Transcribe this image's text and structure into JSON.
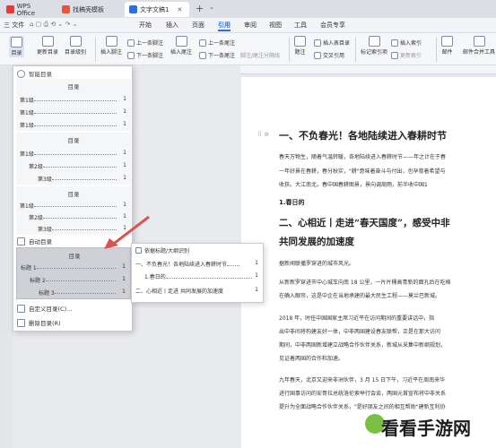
{
  "titlebar": {
    "tabs": [
      "WPS Office",
      "找稿壳模板",
      "文字文稿1"
    ],
    "add_label": "+"
  },
  "menubar": {
    "file_label": "三 文件",
    "items": [
      "开始",
      "插入",
      "页面",
      "引用",
      "审阅",
      "视图",
      "工具",
      "会员专享"
    ],
    "active": "引用"
  },
  "ribbon": {
    "toc_label": "目录",
    "update_toc_label": "更新目录",
    "toc_level_label": "目录级别",
    "insert_footnote_label": "插入脚注",
    "prev_footnote_label": "上一条脚注",
    "next_footnote_label": "下一条脚注",
    "insert_endnote_label": "插入尾注",
    "prev_endnote_label": "上一条尾注",
    "next_endnote_label": "下一条尾注",
    "note_settings_label": "脚注/尾注分隔线",
    "caption_label": "题注",
    "insert_table_of_figures_label": "插入表目录",
    "cross_ref_label": "交叉引用",
    "mark_index_label": "标记索引项",
    "insert_index_label": "插入索引",
    "update_index_label": "更新索引",
    "mail_label": "邮件",
    "mail_merge_label": "邮件合并工具"
  },
  "toc_panel": {
    "smart_toc_label": "智能目录",
    "group1": {
      "title": "目录",
      "items": [
        {
          "label": "第1级",
          "page": "1"
        },
        {
          "label": "第1级",
          "page": "1"
        },
        {
          "label": "第1级",
          "page": "1"
        }
      ]
    },
    "group2": {
      "title": "目录",
      "items": [
        {
          "label": "第1级",
          "page": "1"
        },
        {
          "label": "第2级",
          "page": "1"
        },
        {
          "label": "第3级",
          "page": "1"
        }
      ]
    },
    "group3": {
      "title": "目录",
      "items": [
        {
          "label": "第1级",
          "page": "1"
        },
        {
          "label": "第2级",
          "page": "1"
        },
        {
          "label": "第3级",
          "page": "1"
        }
      ]
    },
    "auto_toc_label": "自动目录",
    "group4": {
      "title": "目录",
      "items": [
        {
          "label": "标题 1",
          "page": "1"
        },
        {
          "label": "标题 2",
          "page": "1"
        },
        {
          "label": "标题 3",
          "page": "1"
        }
      ]
    },
    "custom_toc_label": "自定义目录(C)...",
    "delete_toc_label": "删除目录(R)"
  },
  "popup": {
    "title": "依据标题/大纲识别",
    "line1": "一、不负春光！各地陆续进入春耕时节",
    "line1_page": "1",
    "line2": "1.春日的",
    "line2_page": "1",
    "line3": "二、心相近丨走进",
    "line3b": "共同发展的加速度",
    "line3_page": "1"
  },
  "document": {
    "h1": "一、不负春光！各地陆续进入春耕时节",
    "p1": "春天万物生，随着气温转暖，各地陆续进入春耕时节——年之计在于春",
    "p2": "一年好景在春耕，春分秋实，\"耕\"意味着奋斗与付出，也孕育着希望与",
    "p3": "收获。大江南北，春中国春耕图景，景向调周雨，前半收中国1",
    "h3": "1.春日的",
    "h2a": "二、心相近丨走进“春天国度”，感受中非",
    "h2b": "共同发展的加速度",
    "p4": "据新闻联播罗穿进的城市风光。",
    "p5": "从新新罗穿进市中心城车向南 18 公里，一片片桶高青新的面孔后在吃格",
    "p6": "在确入眼帘，这是中企在当地承建的最大民生工程——莫兰巴新城。",
    "p7": "2018 年，时任中国国家主席习近平在访问期间的重要讲话中，指",
    "p8": "出中非间将构建友好一体，中非两国建设春友联帮，正是在那大访问",
    "p9": "期间，中非两国新增建立战略合作伙伴关系，新城从采集中新纲规划，",
    "p10": "见证着两国的合作和加速。",
    "p11": "九年春天，北京又迎来非洲伙伴，3 月 15 日下午，习近平在周南来华",
    "p12": "进行国事访问的安哥拉总统洛伦索举行会谈，两国元首宣布将中非关系",
    "p13": "提升为全面战略合作伙伴关系，\"是好朋友之间的相互帮助\"建新互利协"
  },
  "watermark": "看看手游网",
  "colors": {
    "accent": "#2f6fd6",
    "popup_border": "#c8cad0",
    "arrow": "#d9534f"
  }
}
